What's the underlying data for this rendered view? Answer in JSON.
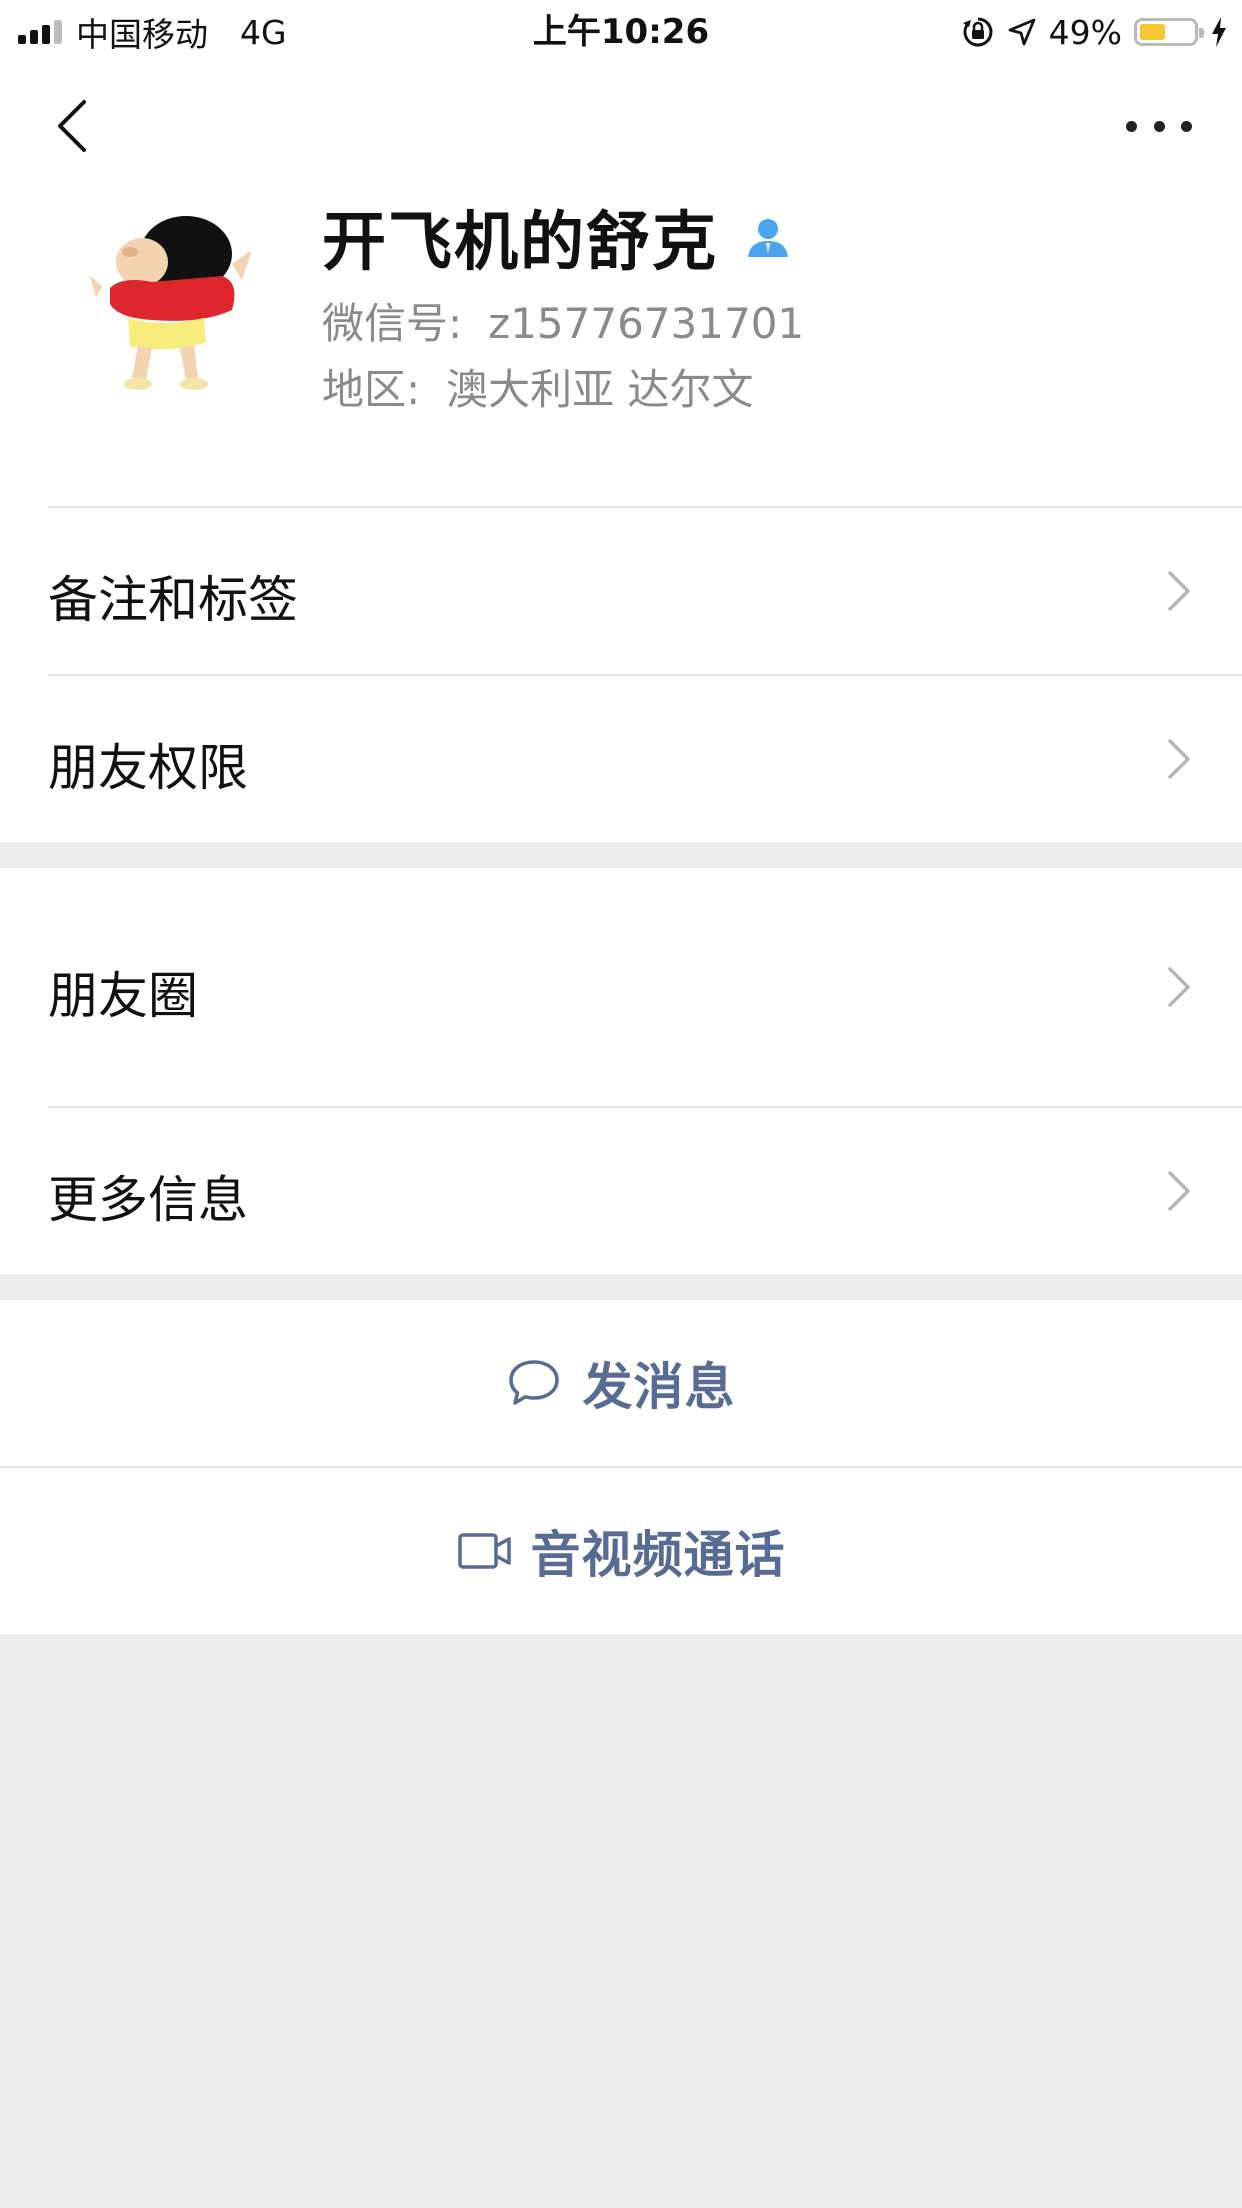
{
  "status_bar": {
    "carrier": "中国移动",
    "network": "4G",
    "time": "上午10:26",
    "battery_percent": "49%",
    "battery_level": 0.49,
    "icons": [
      "signal-icon",
      "rotation-lock-icon",
      "location-icon",
      "battery-icon",
      "charging-icon"
    ]
  },
  "nav": {
    "back_icon": "chevron-left-icon",
    "more_icon": "more-dots-icon"
  },
  "profile": {
    "nickname": "开飞机的舒克",
    "contact_icon_color": "#4ba4f2",
    "wechat_id_label": "微信号:",
    "wechat_id": "z15776731701",
    "region_label": "地区:",
    "region": "澳大利亚 达尔文"
  },
  "menu": {
    "group1": [
      {
        "label": "备注和标签"
      },
      {
        "label": "朋友权限"
      }
    ],
    "group2": [
      {
        "label": "朋友圈"
      },
      {
        "label": "更多信息"
      }
    ]
  },
  "actions": {
    "message_label": "发消息",
    "video_call_label": "音视频通话",
    "link_color": "#576b95"
  }
}
